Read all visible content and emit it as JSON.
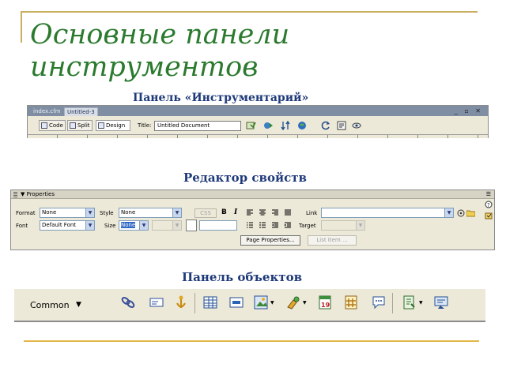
{
  "slide": {
    "title": "Основные панели инструментов",
    "captions": {
      "document_toolbar": "Панель «Инструментарий»",
      "property_inspector": "Редактор свойств",
      "insert_bar": "Панель объектов"
    }
  },
  "document_toolbar": {
    "tabs": [
      "index.cfm",
      "Untitled-3"
    ],
    "window_controls": "_ ▫ ✕",
    "view_buttons": {
      "code": "Code",
      "split": "Split",
      "design": "Design"
    },
    "title_label": "Title:",
    "title_value": "Untitled Document",
    "icons": [
      "file-management-icon",
      "preview-debug-icon",
      "validate-markup-icon",
      "browser-check-icon",
      "refresh-icon",
      "view-options-icon",
      "visual-aids-icon"
    ]
  },
  "property_inspector": {
    "panel_title": "▼ Properties",
    "menu_glyph": "☰",
    "format_label": "Format",
    "format_value": "None",
    "style_label": "Style",
    "style_value": "None",
    "css_button": "CSS",
    "bold_glyph": "B",
    "italic_glyph": "I",
    "link_label": "Link",
    "link_value": "",
    "font_label": "Font",
    "font_value": "Default Font",
    "size_label": "Size",
    "size_value": "None",
    "target_label": "Target",
    "target_value": "",
    "page_properties_button": "Page Properties...",
    "list_item_button": "List Item ..."
  },
  "insert_bar": {
    "category": "Common",
    "category_arrow": "▼",
    "icons": [
      "hyperlink-icon",
      "email-link-icon",
      "named-anchor-icon",
      "table-icon",
      "insert-div-icon",
      "image-icon",
      "media-icon",
      "date-icon",
      "server-side-include-icon",
      "comment-icon",
      "templates-icon",
      "tag-chooser-icon"
    ]
  },
  "colors": {
    "title": "#2b7a2e",
    "captions": "#1f3a7a",
    "gold_rule": "#e2b84a",
    "panel_bg": "#ece9d8"
  }
}
